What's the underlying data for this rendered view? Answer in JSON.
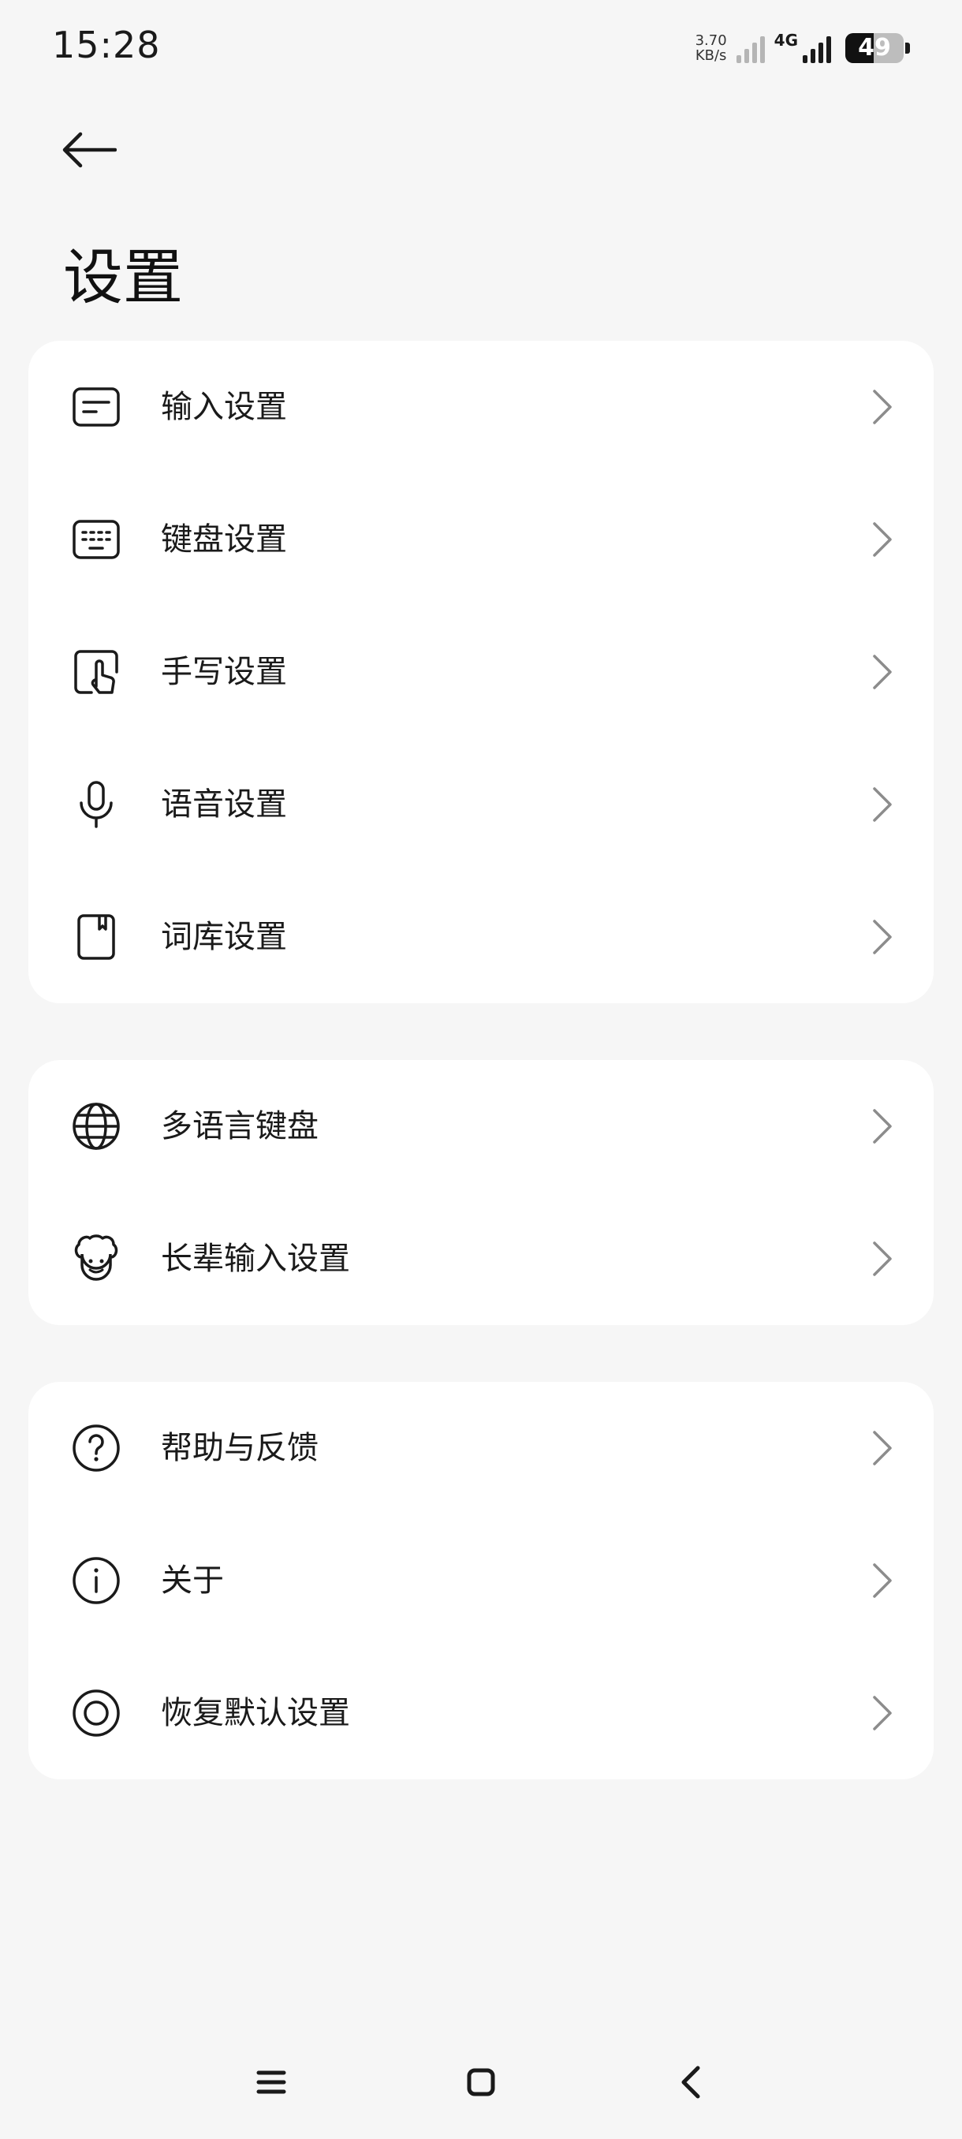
{
  "status_bar": {
    "time": "15:28",
    "net_speed_value": "3.70",
    "net_speed_unit": "KB/s",
    "network_type": "4G",
    "battery_percent": "49",
    "battery_level": 0.49,
    "icons": [
      "signal-sim1-icon",
      "signal-sim2-icon",
      "battery-icon"
    ]
  },
  "header": {
    "back_icon": "arrow-left-icon",
    "title": "设置"
  },
  "groups": [
    {
      "items": [
        {
          "label": "输入设置",
          "icon": "input-settings-icon"
        },
        {
          "label": "键盘设置",
          "icon": "keyboard-icon"
        },
        {
          "label": "手写设置",
          "icon": "handwriting-icon"
        },
        {
          "label": "语音设置",
          "icon": "microphone-icon"
        },
        {
          "label": "词库设置",
          "icon": "dictionary-icon"
        }
      ]
    },
    {
      "items": [
        {
          "label": "多语言键盘",
          "icon": "globe-icon"
        },
        {
          "label": "长辈输入设置",
          "icon": "elder-face-icon"
        }
      ]
    },
    {
      "items": [
        {
          "label": "帮助与反馈",
          "icon": "help-icon"
        },
        {
          "label": "关于",
          "icon": "info-icon"
        },
        {
          "label": "恢复默认设置",
          "icon": "restore-icon"
        }
      ]
    }
  ],
  "nav_bar": {
    "icons": [
      "menu-icon",
      "home-icon",
      "back-icon"
    ]
  },
  "colors": {
    "background": "#f6f6f6",
    "card": "#ffffff",
    "text": "#1a1a1a",
    "chevron": "#8c8c8c"
  }
}
